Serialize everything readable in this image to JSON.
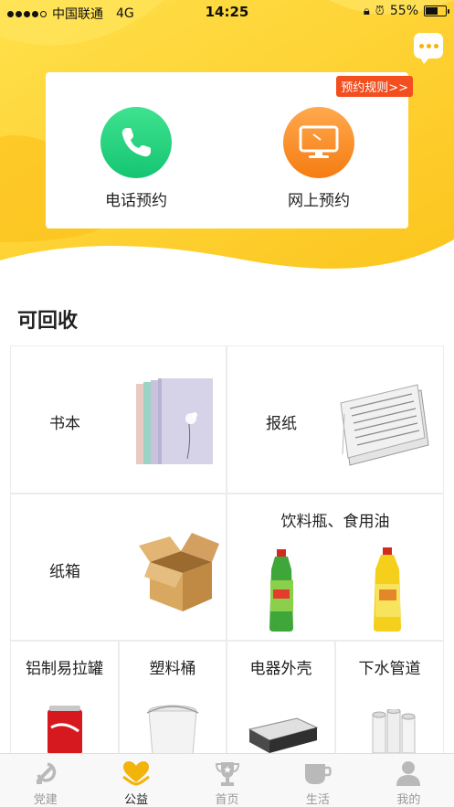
{
  "status_bar": {
    "carrier": "中国联通",
    "network": "4G",
    "time": "14:25",
    "battery": "55%"
  },
  "chat_icon": "chat-bubble-icon",
  "appointment": {
    "rules_link": "预约规则>>",
    "phone_label": "电话预约",
    "online_label": "网上预约"
  },
  "section_title": "可回收",
  "recyclables": {
    "books": "书本",
    "newspaper": "报纸",
    "cardboard": "纸箱",
    "bottles_oil": "饮料瓶、食用油",
    "cans": "铝制易拉罐",
    "plastic_bucket": "塑料桶",
    "appliance_shell": "电器外壳",
    "drain_pipe": "下水管道"
  },
  "tabs": [
    {
      "label": "党建",
      "icon": "party-emblem-icon",
      "active": false
    },
    {
      "label": "公益",
      "icon": "heart-hands-icon",
      "active": true
    },
    {
      "label": "首页",
      "icon": "trophy-icon",
      "active": false
    },
    {
      "label": "生活",
      "icon": "cup-icon",
      "active": false
    },
    {
      "label": "我的",
      "icon": "person-icon",
      "active": false
    }
  ],
  "colors": {
    "brand_yellow": "#FDD22A",
    "phone_green": "#1FCB7A",
    "online_orange": "#F7861C",
    "rules_red": "#F24E1E",
    "active_tab": "#F2B40A"
  }
}
